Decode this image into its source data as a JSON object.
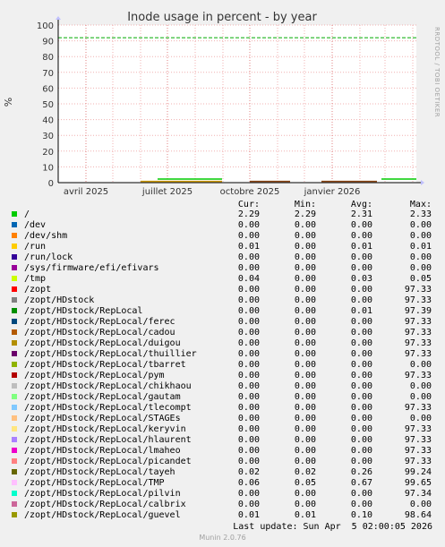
{
  "chart_data": {
    "type": "line",
    "title": "Inode usage in percent - by year",
    "ylabel": "%",
    "xlabel": "",
    "ylim": [
      0,
      100
    ],
    "y_ticks": [
      0,
      10,
      20,
      30,
      40,
      50,
      60,
      70,
      80,
      90,
      100
    ],
    "x_ticks": [
      "avril 2025",
      "juillet 2025",
      "octobre 2025",
      "janvier 2026"
    ],
    "x_range": [
      "2025-03-01",
      "2026-04-05"
    ],
    "warning_line": 92,
    "grid": true,
    "series_markers": [
      {
        "start": "2025-06-20",
        "end": "2025-08-31",
        "value": 2.3,
        "color": "#00cc00"
      },
      {
        "start": "2025-06-01",
        "end": "2025-08-31",
        "value": 0.8,
        "color": "#cc9900"
      },
      {
        "start": "2025-10-01",
        "end": "2025-11-15",
        "value": 0.8,
        "color": "#8b4513"
      },
      {
        "start": "2025-12-20",
        "end": "2026-02-20",
        "value": 0.8,
        "color": "#8b4513"
      },
      {
        "start": "2026-02-25",
        "end": "2026-04-05",
        "value": 2.3,
        "color": "#00cc00"
      }
    ]
  },
  "legend": {
    "headers": {
      "cur": "Cur:",
      "min": "Min:",
      "avg": "Avg:",
      "max": "Max:"
    },
    "rows": [
      {
        "name": "/",
        "color": "#00cc00",
        "cur": "2.29",
        "min": "2.29",
        "avg": "2.31",
        "max": "2.33"
      },
      {
        "name": "/dev",
        "color": "#0066b3",
        "cur": "0.00",
        "min": "0.00",
        "avg": "0.00",
        "max": "0.00"
      },
      {
        "name": "/dev/shm",
        "color": "#ff8000",
        "cur": "0.00",
        "min": "0.00",
        "avg": "0.00",
        "max": "0.00"
      },
      {
        "name": "/run",
        "color": "#ffcc00",
        "cur": "0.01",
        "min": "0.00",
        "avg": "0.01",
        "max": "0.01"
      },
      {
        "name": "/run/lock",
        "color": "#330099",
        "cur": "0.00",
        "min": "0.00",
        "avg": "0.00",
        "max": "0.00"
      },
      {
        "name": "/sys/firmware/efi/efivars",
        "color": "#990099",
        "cur": "0.00",
        "min": "0.00",
        "avg": "0.00",
        "max": "0.00"
      },
      {
        "name": "/tmp",
        "color": "#ccff00",
        "cur": "0.04",
        "min": "0.00",
        "avg": "0.03",
        "max": "0.05"
      },
      {
        "name": "/zopt",
        "color": "#ff0000",
        "cur": "0.00",
        "min": "0.00",
        "avg": "0.00",
        "max": "97.33"
      },
      {
        "name": "/zopt/HDstock",
        "color": "#808080",
        "cur": "0.00",
        "min": "0.00",
        "avg": "0.00",
        "max": "97.33"
      },
      {
        "name": "/zopt/HDstock/RepLocal",
        "color": "#008f00",
        "cur": "0.00",
        "min": "0.00",
        "avg": "0.01",
        "max": "97.39"
      },
      {
        "name": "/zopt/HDstock/RepLocal/ferec",
        "color": "#00487d",
        "cur": "0.00",
        "min": "0.00",
        "avg": "0.00",
        "max": "97.33"
      },
      {
        "name": "/zopt/HDstock/RepLocal/cadou",
        "color": "#b35a00",
        "cur": "0.00",
        "min": "0.00",
        "avg": "0.00",
        "max": "97.33"
      },
      {
        "name": "/zopt/HDstock/RepLocal/duigou",
        "color": "#b38f00",
        "cur": "0.00",
        "min": "0.00",
        "avg": "0.00",
        "max": "97.33"
      },
      {
        "name": "/zopt/HDstock/RepLocal/thuillier",
        "color": "#6b006b",
        "cur": "0.00",
        "min": "0.00",
        "avg": "0.00",
        "max": "97.33"
      },
      {
        "name": "/zopt/HDstock/RepLocal/tbarret",
        "color": "#8fb300",
        "cur": "0.00",
        "min": "0.00",
        "avg": "0.00",
        "max": "0.00"
      },
      {
        "name": "/zopt/HDstock/RepLocal/pym",
        "color": "#b30000",
        "cur": "0.00",
        "min": "0.00",
        "avg": "0.00",
        "max": "97.33"
      },
      {
        "name": "/zopt/HDstock/RepLocal/chikhaou",
        "color": "#bebebe",
        "cur": "0.00",
        "min": "0.00",
        "avg": "0.00",
        "max": "0.00"
      },
      {
        "name": "/zopt/HDstock/RepLocal/gautam",
        "color": "#80ff80",
        "cur": "0.00",
        "min": "0.00",
        "avg": "0.00",
        "max": "0.00"
      },
      {
        "name": "/zopt/HDstock/RepLocal/tlecompt",
        "color": "#80c9ff",
        "cur": "0.00",
        "min": "0.00",
        "avg": "0.00",
        "max": "97.33"
      },
      {
        "name": "/zopt/HDstock/RepLocal/STAGEs",
        "color": "#ffc080",
        "cur": "0.00",
        "min": "0.00",
        "avg": "0.00",
        "max": "0.00"
      },
      {
        "name": "/zopt/HDstock/RepLocal/keryvin",
        "color": "#ffe680",
        "cur": "0.00",
        "min": "0.00",
        "avg": "0.00",
        "max": "97.33"
      },
      {
        "name": "/zopt/HDstock/RepLocal/hlaurent",
        "color": "#aa80ff",
        "cur": "0.00",
        "min": "0.00",
        "avg": "0.00",
        "max": "97.33"
      },
      {
        "name": "/zopt/HDstock/RepLocal/lmaheo",
        "color": "#ee00cc",
        "cur": "0.00",
        "min": "0.00",
        "avg": "0.00",
        "max": "97.33"
      },
      {
        "name": "/zopt/HDstock/RepLocal/picandet",
        "color": "#ff8080",
        "cur": "0.00",
        "min": "0.00",
        "avg": "0.00",
        "max": "97.33"
      },
      {
        "name": "/zopt/HDstock/RepLocal/tayeh",
        "color": "#666600",
        "cur": "0.02",
        "min": "0.02",
        "avg": "0.26",
        "max": "99.24"
      },
      {
        "name": "/zopt/HDstock/RepLocal/TMP",
        "color": "#ffbfff",
        "cur": "0.06",
        "min": "0.05",
        "avg": "0.67",
        "max": "99.65"
      },
      {
        "name": "/zopt/HDstock/RepLocal/pilvin",
        "color": "#00ffcc",
        "cur": "0.00",
        "min": "0.00",
        "avg": "0.00",
        "max": "97.34"
      },
      {
        "name": "/zopt/HDstock/RepLocal/calbrix",
        "color": "#cc6699",
        "cur": "0.00",
        "min": "0.00",
        "avg": "0.00",
        "max": "0.00"
      },
      {
        "name": "/zopt/HDstock/RepLocal/guevel",
        "color": "#999900",
        "cur": "0.01",
        "min": "0.01",
        "avg": "0.10",
        "max": "98.64"
      }
    ]
  },
  "footer": {
    "last_update": "Last update: Sun Apr  5 02:00:05 2026",
    "munin": "Munin 2.0.76",
    "rrdtool": "RRDTOOL / TOBI OETIKER"
  }
}
